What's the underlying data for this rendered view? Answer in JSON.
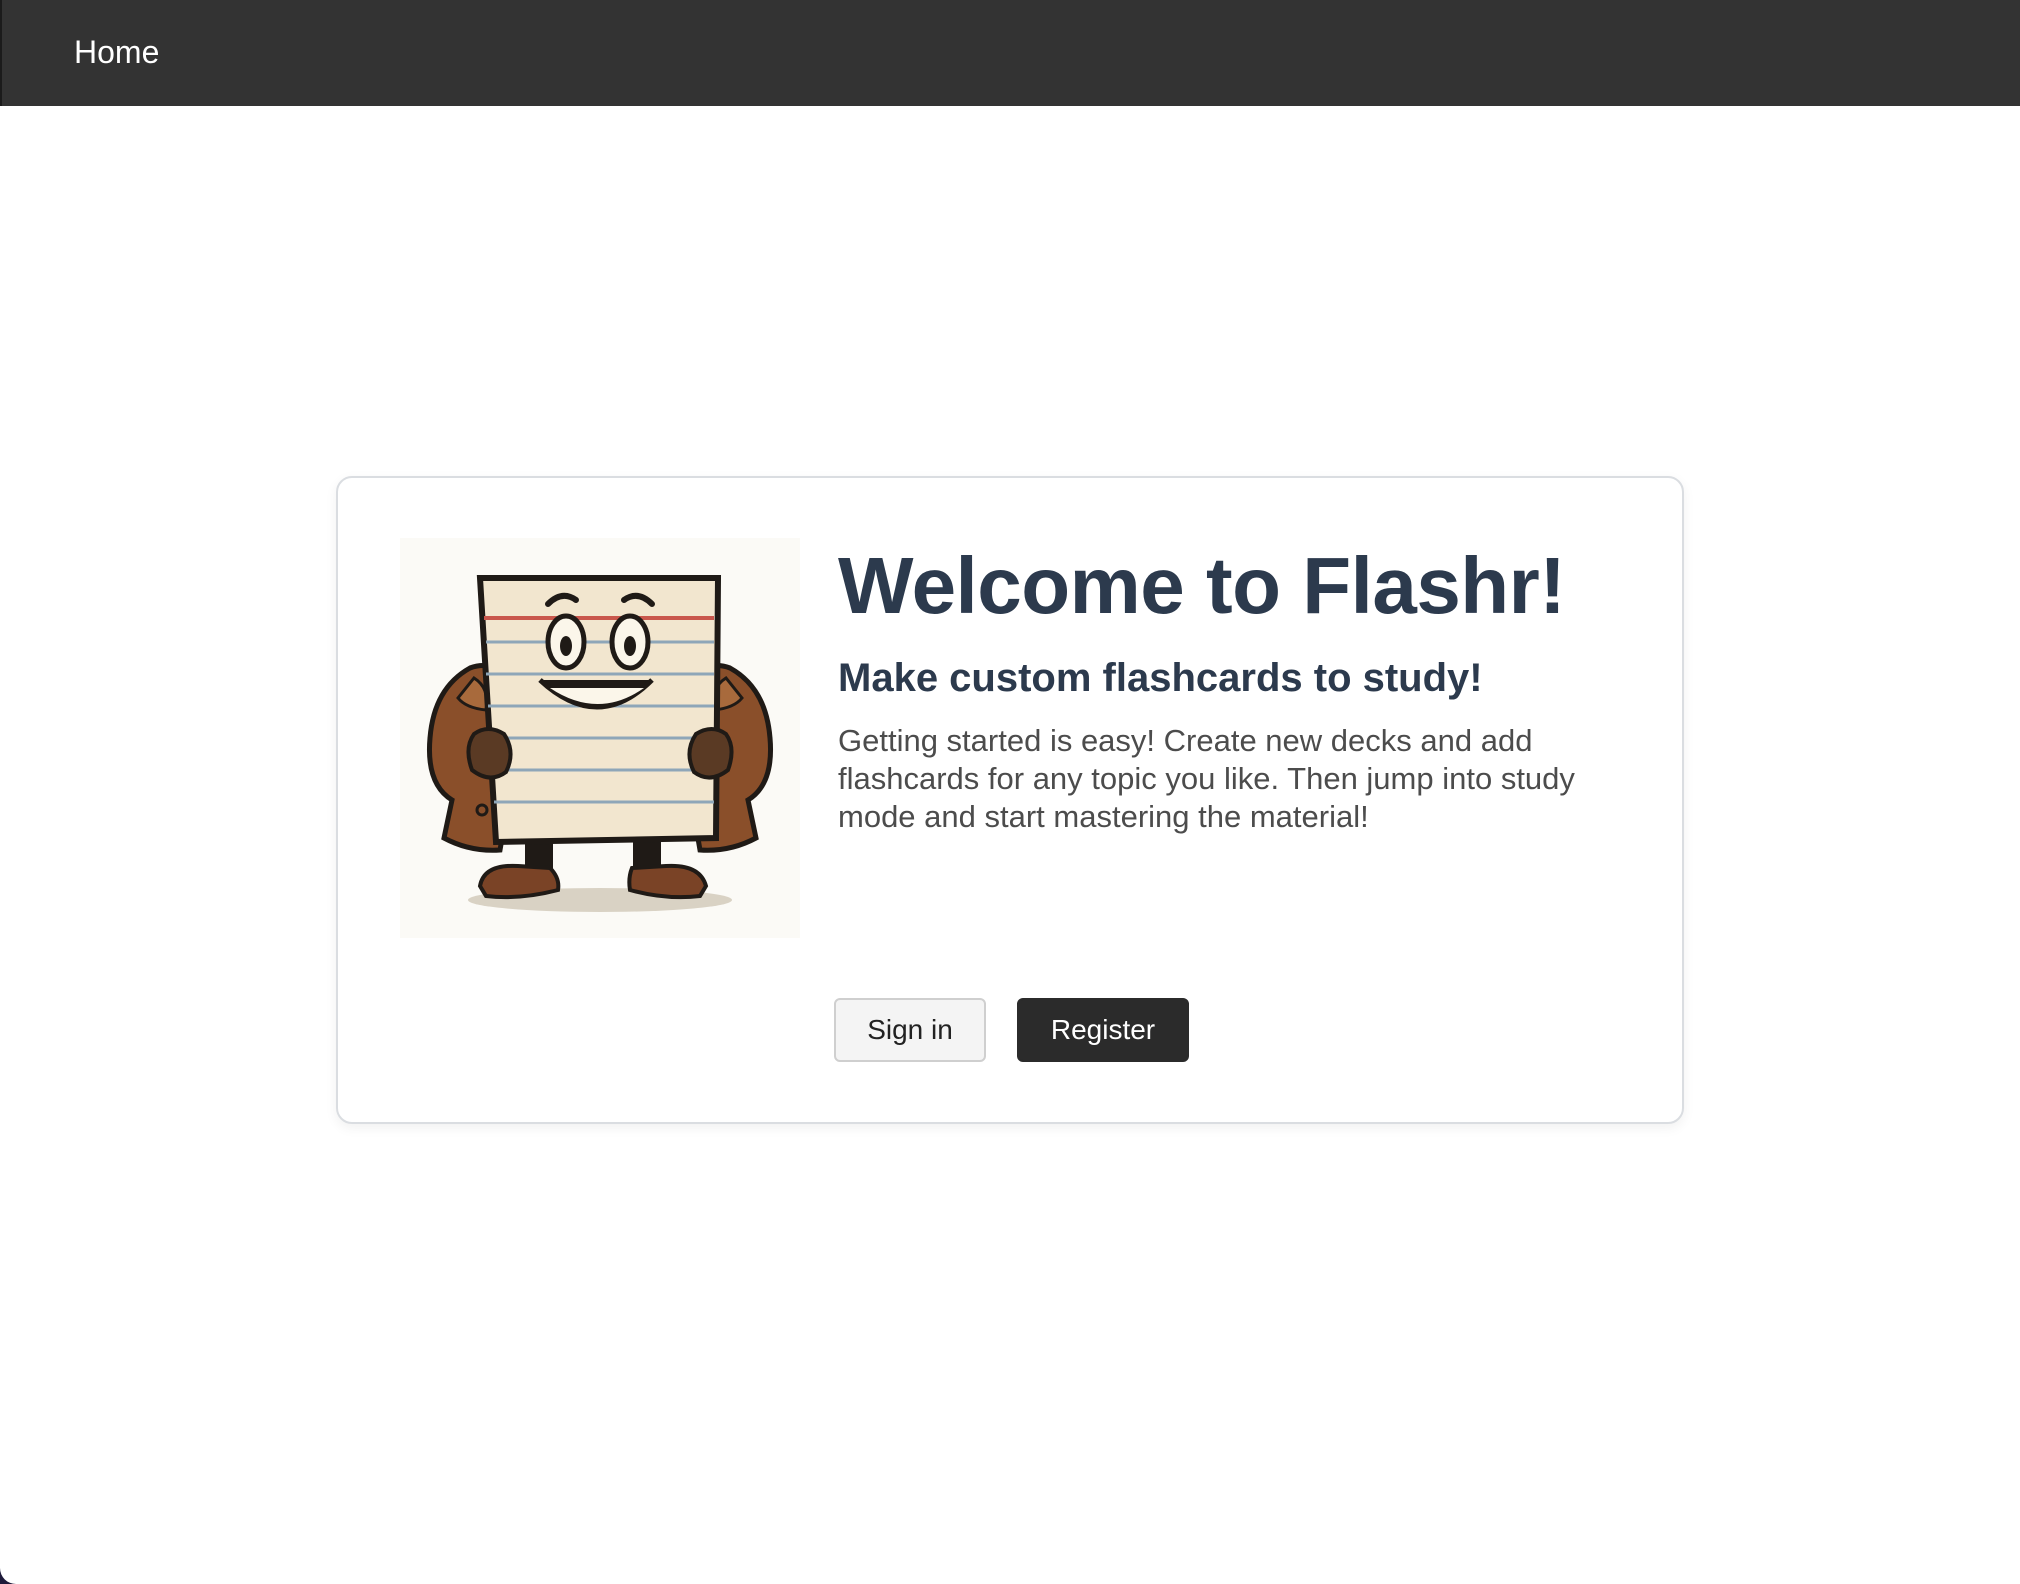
{
  "navbar": {
    "home_label": "Home"
  },
  "hero": {
    "title": "Welcome to Flashr!",
    "subtitle": "Make custom flashcards to study!",
    "description": "Getting started is easy! Create new decks and add flashcards for any topic you like. Then jump into study mode and start mastering the material!",
    "image_icon": "flashcard-mascot-icon"
  },
  "actions": {
    "signin_label": "Sign in",
    "register_label": "Register"
  },
  "colors": {
    "navbar_bg": "#333333",
    "heading": "#2c3a4d",
    "body_text": "#4c4c4c",
    "primary_button": "#2b2b2b",
    "secondary_button": "#f4f4f4"
  }
}
